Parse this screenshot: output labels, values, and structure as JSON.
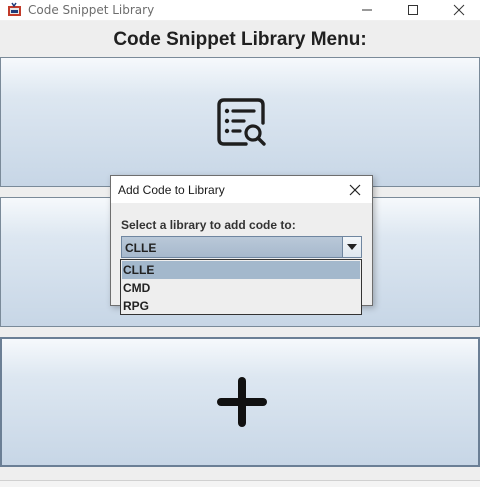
{
  "window": {
    "title": "Code Snippet Library",
    "icons": {
      "app": "java-cup-icon",
      "minimize": "minimize-icon",
      "maximize": "maximize-icon",
      "close": "close-icon"
    }
  },
  "menu": {
    "header": "Code Snippet Library Menu:",
    "buttons": [
      {
        "icon": "view-list-search-icon"
      },
      {
        "icon": ""
      },
      {
        "icon": "add-plus-icon"
      }
    ]
  },
  "dialog": {
    "title": "Add Code to Library",
    "label": "Select a library to add code to:",
    "selected": "CLLE",
    "options": [
      "CLLE",
      "CMD",
      "RPG"
    ],
    "close_icon": "close-icon"
  },
  "colors": {
    "button_gradient_top": "#f6f9fc",
    "button_gradient_bottom": "#c7d6e6",
    "selection": "#a3b8cc"
  }
}
